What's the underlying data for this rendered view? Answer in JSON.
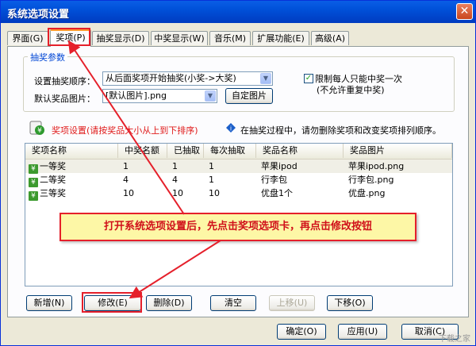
{
  "window": {
    "title": "系统选项设置",
    "close_symbol": "✕"
  },
  "tabs": [
    {
      "label": "界面(G)"
    },
    {
      "label": "奖项(P)",
      "active": true
    },
    {
      "label": "抽奖显示(D)"
    },
    {
      "label": "中奖显示(W)"
    },
    {
      "label": "音乐(M)"
    },
    {
      "label": "扩展功能(E)"
    },
    {
      "label": "高级(A)"
    }
  ],
  "lottery_params": {
    "group_title": "抽奖参数",
    "order_label": "设置抽奖顺序：",
    "order_value": "从后面奖项开始抽奖(小奖->大奖)",
    "image_label": "默认奖品图片：",
    "image_value": "[默认图片].png",
    "custom_image_button": "自定图片",
    "limit_checkbox_label": "限制每人只能中奖一次",
    "limit_checkbox_sublabel": "(不允许重复中奖)",
    "limit_checked": true
  },
  "prize_settings": {
    "title": "奖项设置(请按奖品大小从上到下排序)",
    "info_text": "在抽奖过程中，请勿删除奖项和改变奖项排列顺序。"
  },
  "table": {
    "columns": [
      "奖项名称",
      "中奖名额",
      "已抽取",
      "每次抽取",
      "奖品名称",
      "奖品图片"
    ],
    "rows": [
      [
        "一等奖",
        "1",
        "1",
        "1",
        "苹果ipod",
        "苹果ipod.png"
      ],
      [
        "二等奖",
        "4",
        "4",
        "1",
        "行李包",
        "行李包.png"
      ],
      [
        "三等奖",
        "10",
        "10",
        "10",
        "优盘1个",
        "优盘.png"
      ]
    ],
    "row_icon": "¥"
  },
  "callout": {
    "text": "打开系统选项设置后，先点击奖项选项卡，再点击修改按钮"
  },
  "action_buttons": {
    "add": "新增(N)",
    "edit": "修改(E)",
    "delete": "删除(D)",
    "clear": "清空",
    "move_up": "上移(U)",
    "move_down": "下移(O)"
  },
  "dialog_buttons": {
    "ok": "确定(O)",
    "apply": "应用(U)",
    "cancel": "取消(C)"
  },
  "watermark": "下载之家",
  "colors": {
    "accent_red": "#e5202b",
    "callout_bg": "#fdf7a6",
    "titlebar": "#0054e3"
  }
}
